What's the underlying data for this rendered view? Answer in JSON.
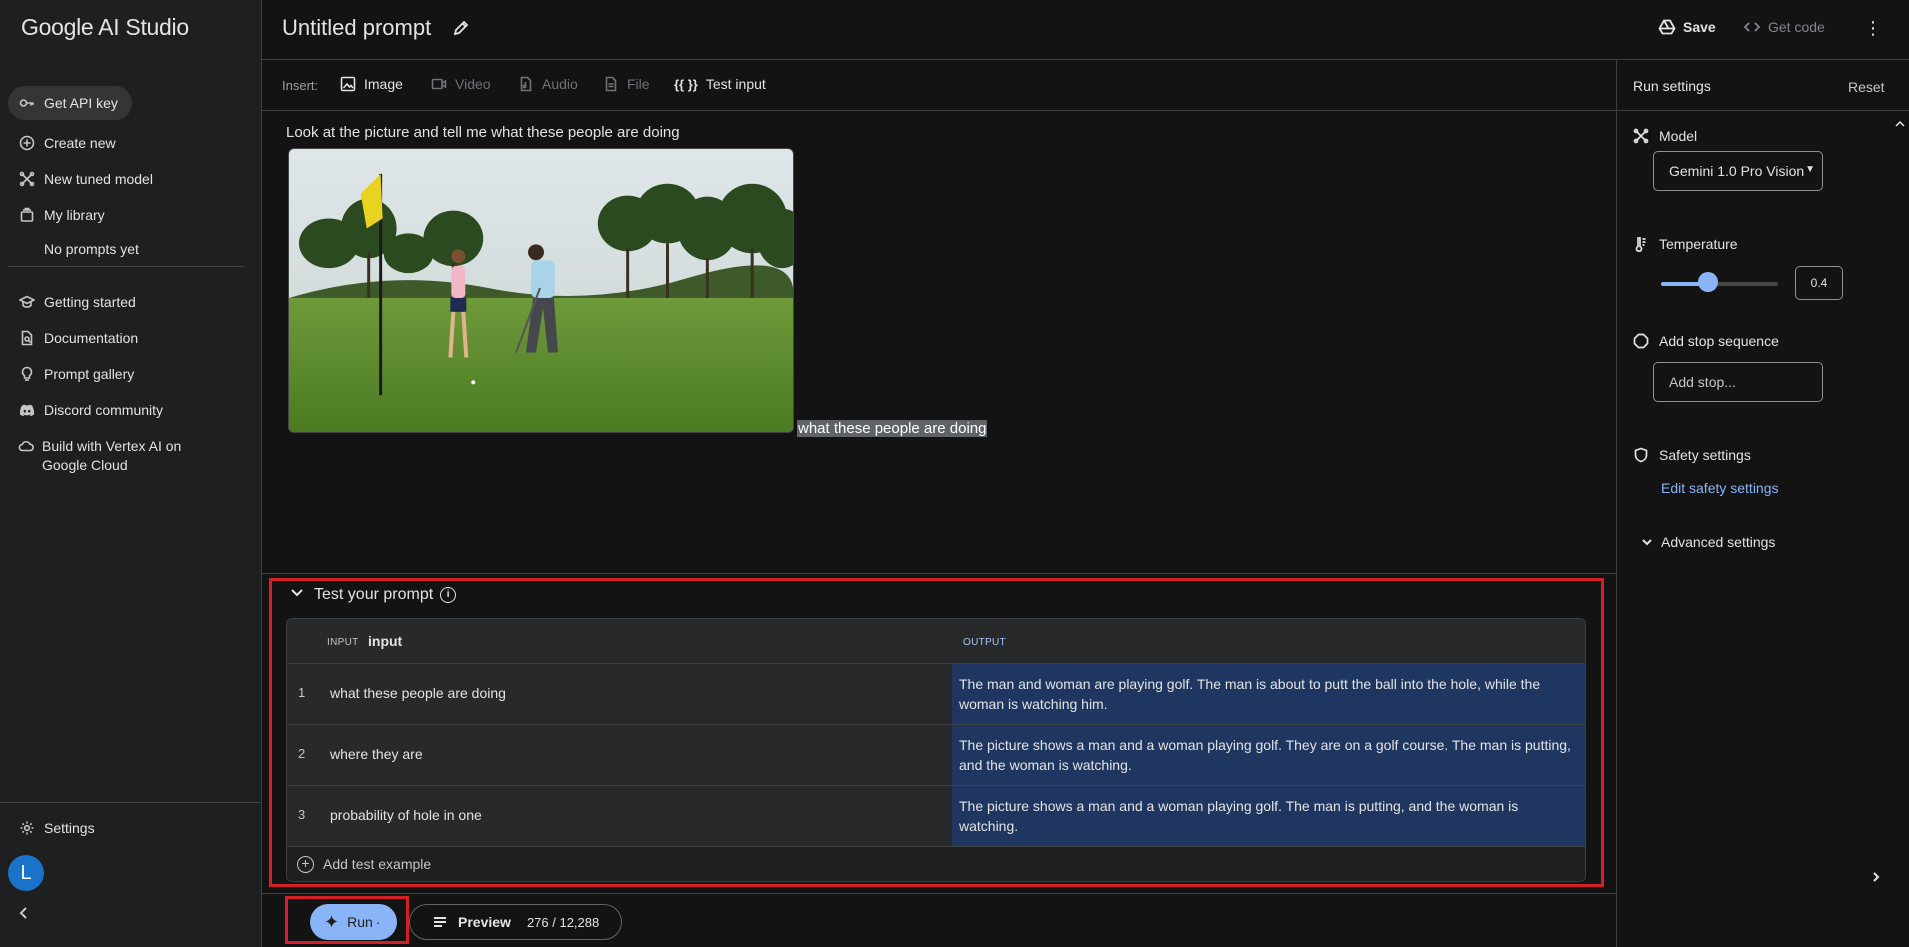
{
  "app": {
    "name": "Google AI Studio"
  },
  "sidebar": {
    "items": [
      {
        "label": "Get API key",
        "icon": "key-icon"
      },
      {
        "label": "Create new",
        "icon": "add-circle-icon"
      },
      {
        "label": "New tuned model",
        "icon": "tune-icon"
      },
      {
        "label": "My library",
        "icon": "library-icon"
      },
      {
        "label": "Getting started",
        "icon": "school-icon"
      },
      {
        "label": "Documentation",
        "icon": "document-search-icon"
      },
      {
        "label": "Prompt gallery",
        "icon": "lightbulb-icon"
      },
      {
        "label": "Discord community",
        "icon": "discord-icon"
      },
      {
        "label": "Build with Vertex AI on Google Cloud",
        "icon": "cloud-icon"
      },
      {
        "label": "Settings",
        "icon": "gear-icon"
      }
    ],
    "library_empty": "No prompts yet",
    "avatar_letter": "L"
  },
  "header": {
    "title": "Untitled prompt",
    "save_label": "Save",
    "getcode_label": "Get code"
  },
  "insert_bar": {
    "label": "Insert:",
    "items": [
      {
        "label": "Image",
        "icon": "image-icon",
        "enabled": true
      },
      {
        "label": "Video",
        "icon": "video-icon",
        "enabled": false
      },
      {
        "label": "Audio",
        "icon": "audio-icon",
        "enabled": false
      },
      {
        "label": "File",
        "icon": "file-icon",
        "enabled": false
      },
      {
        "label": "Test input",
        "icon": "braces-icon",
        "braces": "{{ }}",
        "enabled": true
      }
    ]
  },
  "prompt": {
    "text": "Look at the picture and tell me what these people are doing",
    "variable_highlight": "what these people are doing"
  },
  "test": {
    "title": "Test your prompt",
    "col_input_small": "INPUT",
    "col_input": "input",
    "col_output": "OUTPUT",
    "rows": [
      {
        "num": "1",
        "input": "what these people are doing",
        "output": "The man and woman are playing golf. The man is about to putt the ball into the hole, while the woman is watching him."
      },
      {
        "num": "2",
        "input": "where they are",
        "output": "The picture shows a man and a woman playing golf. They are on a golf course. The man is putting, and the woman is watching."
      },
      {
        "num": "3",
        "input": "probability of hole in one",
        "output": "The picture shows a man and a woman playing golf. The man is putting, and the woman is watching."
      }
    ],
    "add_label": "Add test example"
  },
  "bottom": {
    "run_label": "Run",
    "run_suffix": "·",
    "preview_label": "Preview",
    "token_count": "276 / 12,288"
  },
  "settings": {
    "title": "Run settings",
    "reset_label": "Reset",
    "model_label": "Model",
    "model_value": "Gemini 1.0 Pro Vision",
    "temperature_label": "Temperature",
    "temperature_value": "0.4",
    "temperature_fraction": 0.4,
    "stop_label": "Add stop sequence",
    "stop_placeholder": "Add stop...",
    "safety_label": "Safety settings",
    "safety_link": "Edit safety settings",
    "advanced_label": "Advanced settings"
  },
  "colors": {
    "accent": "#8ab4f8",
    "highlight_frame": "#d32027",
    "output_bg": "#1f3760"
  }
}
